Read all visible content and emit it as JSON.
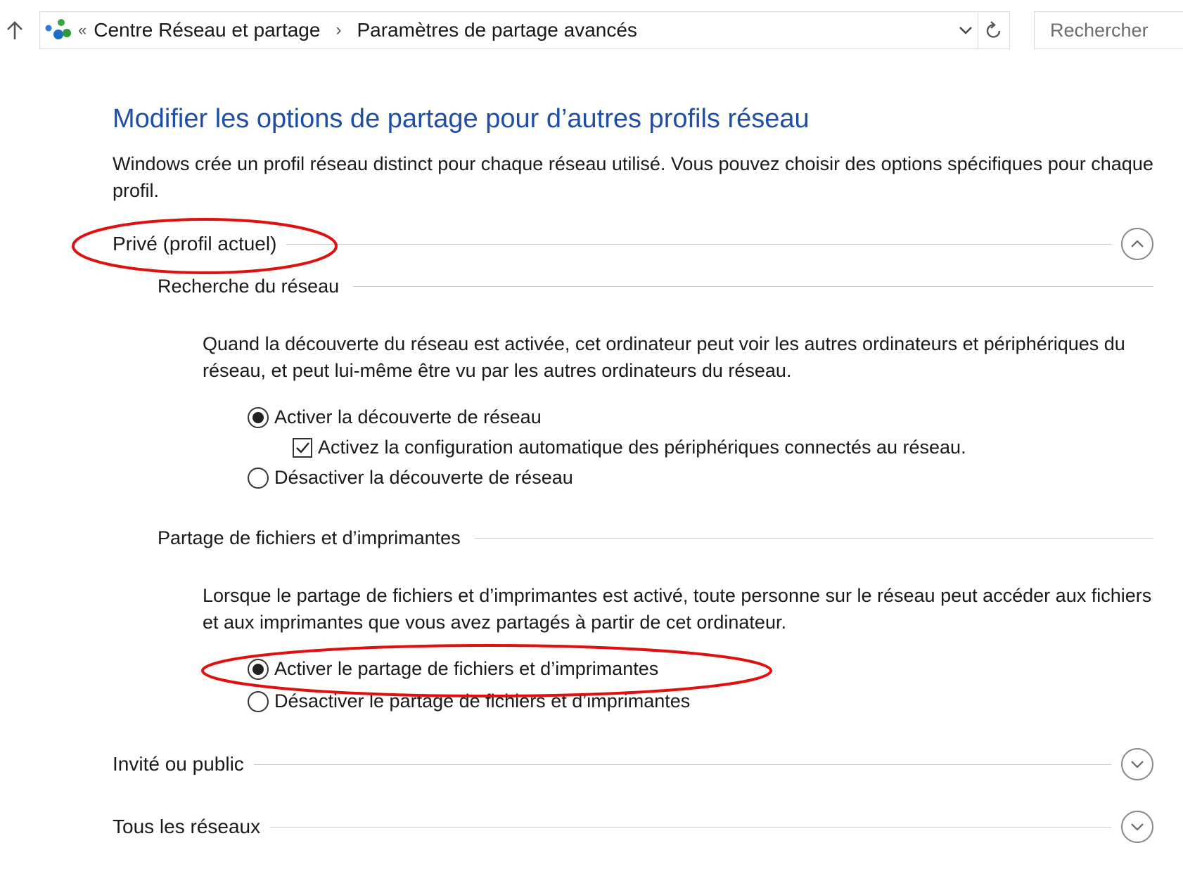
{
  "navigation": {
    "up_icon": "up-arrow-icon",
    "network_icon": "network-icon",
    "breadcrumb_prefix": "«",
    "breadcrumbs": [
      "Centre Réseau et partage",
      "Paramètres de partage avancés"
    ],
    "breadcrumb_separator": "›",
    "dropdown_icon": "chevron-down-icon",
    "refresh_icon": "refresh-icon",
    "search_placeholder": "Rechercher"
  },
  "page": {
    "title": "Modifier les options de partage pour d’autres profils réseau",
    "description": "Windows crée un profil réseau distinct pour chaque réseau utilisé. Vous pouvez choisir des options spécifiques pour chaque profil."
  },
  "profiles": {
    "private": {
      "label": "Privé (profil actuel)",
      "expanded": true,
      "network_discovery": {
        "heading": "Recherche du réseau",
        "description": "Quand la découverte du réseau est activée, cet ordinateur peut voir les autres ordinateurs et périphériques du réseau, et peut lui-même être vu par les autres ordinateurs du réseau.",
        "enable_label": "Activer la découverte de réseau",
        "enable_selected": true,
        "auto_config_label": "Activez la configuration automatique des périphériques connectés au réseau.",
        "auto_config_checked": true,
        "disable_label": "Désactiver la découverte de réseau",
        "disable_selected": false
      },
      "file_sharing": {
        "heading": "Partage de fichiers et d’imprimantes",
        "description": "Lorsque le partage de fichiers et d’imprimantes est activé, toute personne sur le réseau peut accéder aux fichiers et aux imprimantes que vous avez partagés à partir de cet ordinateur.",
        "enable_label": "Activer le partage de fichiers et d’imprimantes",
        "enable_selected": true,
        "disable_label": "Désactiver le partage de fichiers et d’imprimantes",
        "disable_selected": false
      }
    },
    "guest": {
      "label": "Invité ou public",
      "expanded": false
    },
    "all": {
      "label": "Tous les réseaux",
      "expanded": false
    }
  },
  "colors": {
    "title_blue": "#1e4fa8",
    "annotation_red": "#e01010"
  }
}
